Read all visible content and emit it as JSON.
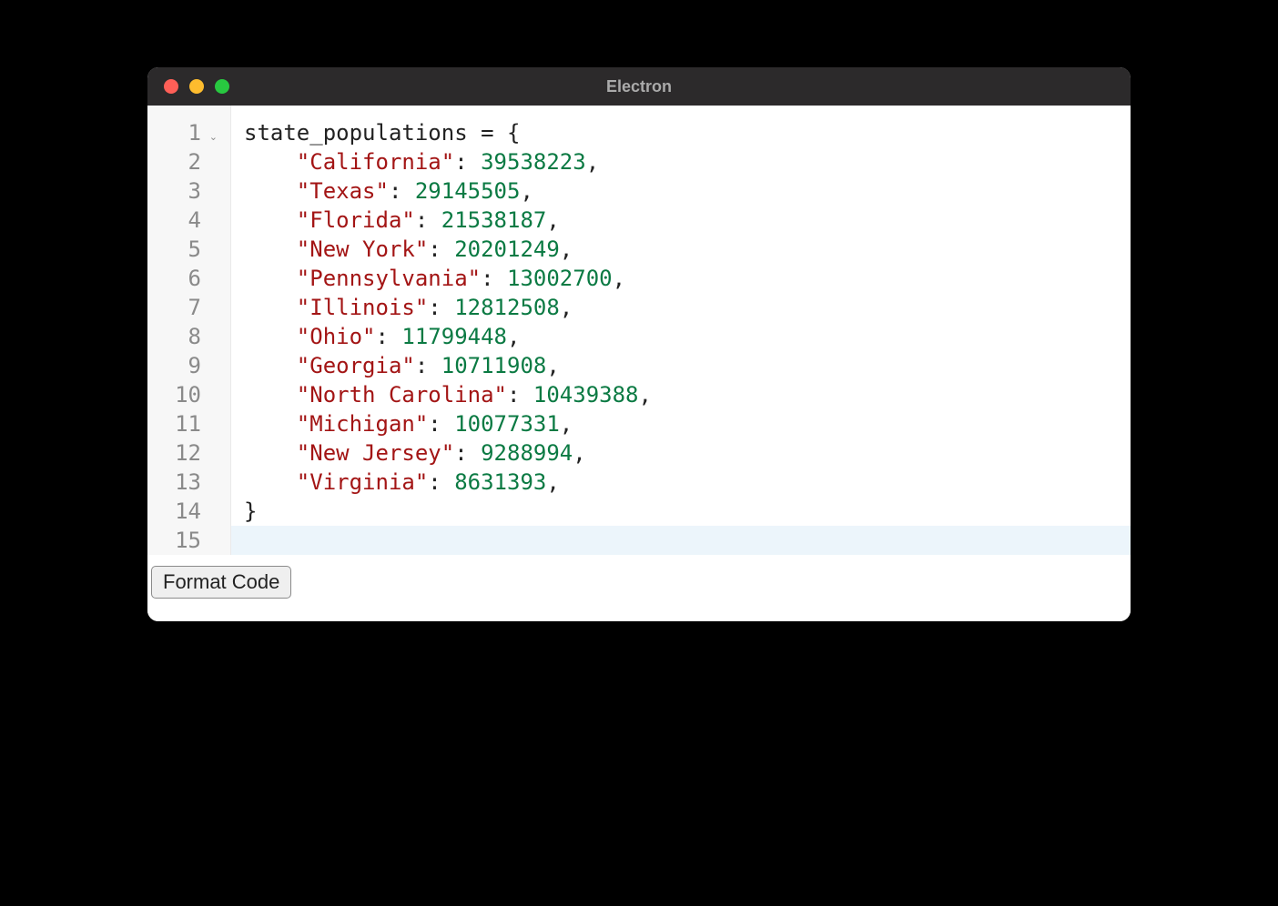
{
  "window": {
    "title": "Electron"
  },
  "editor": {
    "line_numbers": [
      "1",
      "2",
      "3",
      "4",
      "5",
      "6",
      "7",
      "8",
      "9",
      "10",
      "11",
      "12",
      "13",
      "14",
      "15"
    ],
    "fold_line": 1,
    "active_line": 15,
    "variable_name": "state_populations",
    "assign": " = ",
    "open_brace": "{",
    "close_brace": "}",
    "indent": "    ",
    "entries": [
      {
        "key": "California",
        "value": "39538223"
      },
      {
        "key": "Texas",
        "value": "29145505"
      },
      {
        "key": "Florida",
        "value": "21538187"
      },
      {
        "key": "New York",
        "value": "20201249"
      },
      {
        "key": "Pennsylvania",
        "value": "13002700"
      },
      {
        "key": "Illinois",
        "value": "12812508"
      },
      {
        "key": "Ohio",
        "value": "11799448"
      },
      {
        "key": "Georgia",
        "value": "10711908"
      },
      {
        "key": "North Carolina",
        "value": "10439388"
      },
      {
        "key": "Michigan",
        "value": "10077331"
      },
      {
        "key": "New Jersey",
        "value": "9288994"
      },
      {
        "key": "Virginia",
        "value": "8631393"
      }
    ],
    "colon": ": ",
    "comma": ",",
    "quote": "\""
  },
  "controls": {
    "format_label": "Format Code"
  }
}
